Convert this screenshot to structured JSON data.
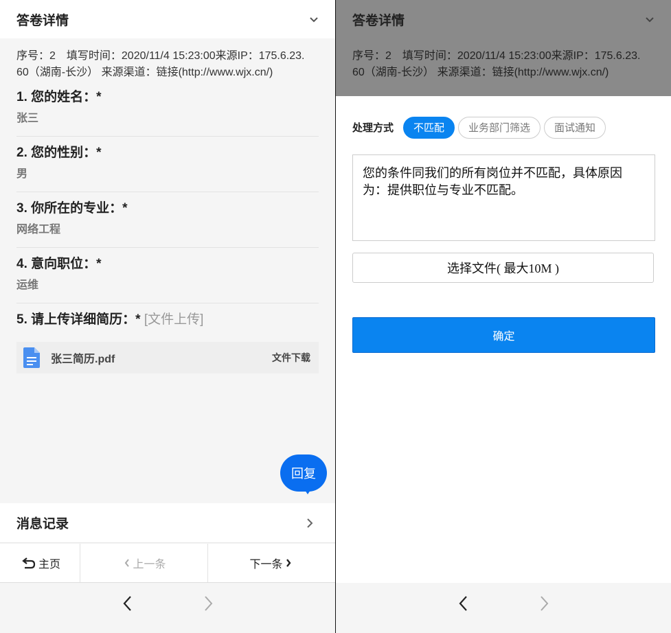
{
  "left": {
    "header": {
      "title": "答卷详情"
    },
    "meta_line1": "序号：2　填写时间：2020/11/4 15:23:00来源IP：175.6.23.",
    "meta_line2": "60（湖南-长沙） 来源渠道：链接(http://www.wjx.cn/)",
    "questions": [
      {
        "title": "1. 您的姓名：*",
        "answer": "张三"
      },
      {
        "title": "2. 您的性别：*",
        "answer": "男"
      },
      {
        "title": "3. 你所在的专业：*",
        "answer": "网络工程"
      },
      {
        "title": "4. 意向职位：*",
        "answer": "运维"
      },
      {
        "title": "5. 请上传详细简历：*",
        "tag": "[文件上传]"
      }
    ],
    "file": {
      "icon": "document-icon",
      "name": "张三简历.pdf",
      "action": "文件下载"
    },
    "reply_button": "回复",
    "message_record": "消息记录",
    "nav": {
      "home": "主页",
      "prev": "上一条",
      "next": "下一条"
    }
  },
  "right": {
    "header": {
      "title": "答卷详情"
    },
    "meta_line1": "序号：2　填写时间：2020/11/4 15:23:00来源IP：175.6.23.",
    "meta_line2": "60（湖南-长沙） 来源渠道：链接(http://www.wjx.cn/)",
    "process_label": "处理方式",
    "options": [
      "不匹配",
      "业务部门筛选",
      "面试通知"
    ],
    "selected_option": "不匹配",
    "reply_text": "您的条件同我们的所有岗位并不匹配，具体原因为：提供职位与专业不匹配。",
    "choose_file": "选择文件( 最大10M )",
    "confirm": "确定"
  },
  "colors": {
    "accent": "#0a84f0",
    "reply_bubble": "#0a6ef0",
    "overlay": "#8a8a8a"
  }
}
